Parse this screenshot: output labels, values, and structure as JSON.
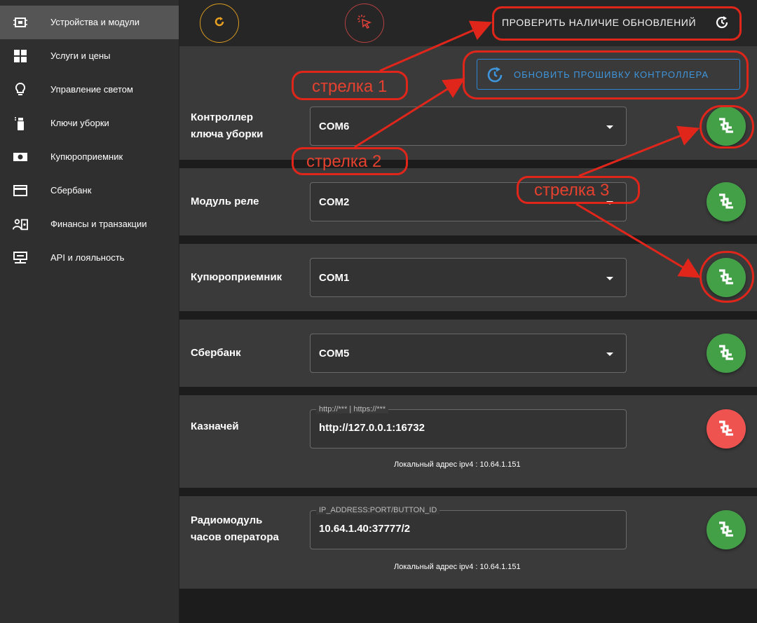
{
  "sidebar": {
    "items": [
      {
        "label": "Устройства и модули",
        "icon": "chip-icon",
        "active": true
      },
      {
        "label": "Услуги и цены",
        "icon": "grid-icon"
      },
      {
        "label": "Управление светом",
        "icon": "bulb-icon"
      },
      {
        "label": "Ключи уборки",
        "icon": "spray-icon"
      },
      {
        "label": "Купюроприемник",
        "icon": "banknote-icon"
      },
      {
        "label": "Сбербанк",
        "icon": "card-icon"
      },
      {
        "label": "Финансы и транзакции",
        "icon": "finance-icon"
      },
      {
        "label": "API и лояльность",
        "icon": "api-icon"
      }
    ]
  },
  "toolbar": {
    "check_updates_label": "ПРОВЕРИТЬ НАЛИЧИЕ ОБНОВЛЕНИЙ",
    "firmware_label": "ОБНОВИТЬ ПРОШИВКУ КОНТРОЛЛЕРА"
  },
  "devices": [
    {
      "label_line1": "Контроллер",
      "label_line2": "ключа уборки",
      "value": "COM6",
      "status": "ok"
    },
    {
      "label_line1": "Модуль реле",
      "value": "COM2",
      "status": "ok"
    },
    {
      "label_line1": "Купюроприемник",
      "value": "COM1",
      "status": "ok"
    },
    {
      "label_line1": "Сбербанк",
      "value": "COM5",
      "status": "ok"
    },
    {
      "label_line1": "Казначей",
      "legend": "http://*** | https://***",
      "value": "http://127.0.0.1:16732",
      "local_address": "Локальный адрес ipv4 : 10.64.1.151",
      "status": "error"
    },
    {
      "label_line1": "Радиомодуль",
      "label_line2": "часов оператора",
      "legend": "IP_ADDRESS:PORT/BUTTON_ID",
      "value": "10.64.1.40:37777/2",
      "local_address": "Локальный адрес ipv4 : 10.64.1.151",
      "status": "ok"
    }
  ],
  "annotations": {
    "arrow1": "стрелка 1",
    "arrow2": "стрелка 2",
    "arrow3": "стрелка 3"
  },
  "colors": {
    "ok": "#43a047",
    "error": "#ef5350",
    "accent_blue": "#3f95db",
    "annotation_red": "#e0261b"
  }
}
